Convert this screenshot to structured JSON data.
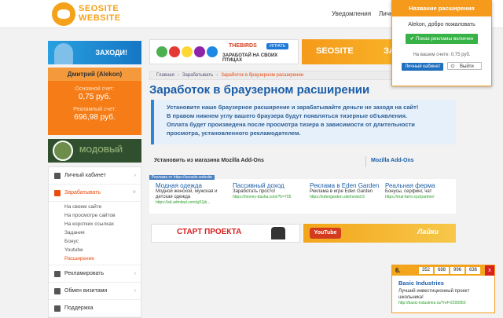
{
  "header": {
    "logo_line1": "SEOSITE",
    "logo_line2": "WEBSITE",
    "notifications": "Уведомления",
    "personal": "Личн"
  },
  "sidebar": {
    "enter_label": "ЗАХОДИ!",
    "user": {
      "name": "Дмитрий (Alekon)",
      "main_label": "Основной счет:",
      "main_value": "0,75 руб.",
      "ad_label": "Рекламный счет:",
      "ad_value": "696,98 руб."
    },
    "thumb_text": "МОДОВЫЙ",
    "menu": [
      {
        "label": "Личный кабинет"
      },
      {
        "label": "Зарабатывать"
      },
      {
        "label": "Рекламировать"
      },
      {
        "label": "Обмен визитами"
      },
      {
        "label": "Поддержка"
      }
    ],
    "submenu": [
      "На своем сайте",
      "На просмотре сайтов",
      "На коротких ссылках",
      "Задания",
      "Бонус",
      "Youtube",
      "Расширение"
    ]
  },
  "ads": {
    "birds_brand": "THEBIRDS",
    "birds_play": "ИГРАТЬ",
    "birds_slogan": "ЗАРАБОТАЙ НА СВОИХ ПТИЦАХ",
    "seosite_banner": "SEOSITE",
    "seosite_tail": "ЗАРА",
    "start_banner": "СТАРТ ПРОЕКТА",
    "yt_label": "YouTube",
    "likes_label": "Лайки"
  },
  "breadcrumbs": [
    "Главная",
    "Зарабатывать",
    "Заработок в браузерном расширении"
  ],
  "page_title": "Заработок в браузерном расширении",
  "notice": {
    "line1": "Установите наше браузерное расширение и зарабатывайте деньги не заходя на сайт!",
    "line2": "В правом нижнем углу вашего браузера будут появляться тизерные объявления.",
    "line3": "Оплата будет произведена после просмотра тизера в зависимости от длительности",
    "line4": "просмотра, установленного рекламодателем."
  },
  "install": {
    "label": "Установить из магазина Mozilla Add-Ons",
    "link": "Mozilla Add-Ons"
  },
  "teasers": {
    "tag": "Реклама от https://seosite.website",
    "items": [
      {
        "title": "Модная одежда",
        "desc": "Модной женской, мужская и детская одежда",
        "url": "https://ad.admitad.com/g/11jb..."
      },
      {
        "title": "Пассивный доход",
        "desc": "Заработать просто!",
        "url": "https://money-basha.com/?h=705"
      },
      {
        "title": "Реклама в Eden Garden",
        "desc": "Реклама в игре Eden Garden",
        "url": "https://edengarden.site/news/r3"
      },
      {
        "title": "Реальная ферма",
        "desc": "Бонусы, серфинг, чат",
        "url": "https://real-farm.xyz/partner/"
      }
    ]
  },
  "popup": {
    "title": "Название расширения",
    "greeting": "Alekon, добро пожаловать",
    "toggle": "Показ рекламы включен",
    "balance": "На вашем счете: 0,75 руб.",
    "cabinet": "Личный кабинет",
    "logout": "Выйти"
  },
  "teaser_badge": {
    "counters": [
      "352",
      "688",
      "996",
      "636"
    ],
    "title": "Basic Industries",
    "desc": "Лучший инвестиционный проект школьника!",
    "url": "http://basic-industries.ru/?ref=2200950"
  },
  "colors": {
    "accent": "#f59a1b",
    "link": "#1a5ea8",
    "active": "#e84b0c",
    "ok": "#37b247"
  }
}
